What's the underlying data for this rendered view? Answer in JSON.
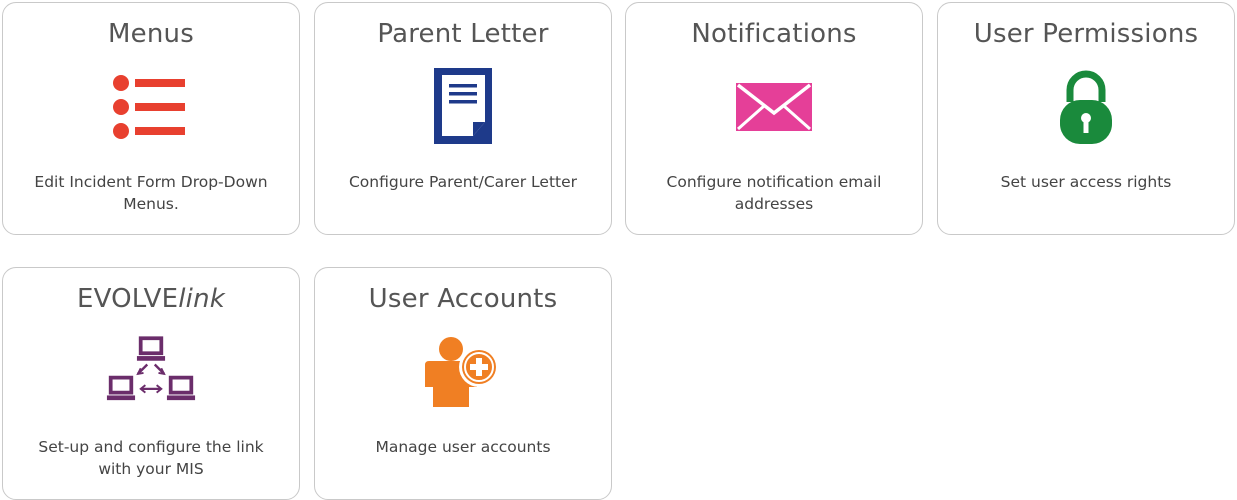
{
  "cards": [
    {
      "title": "Menus",
      "description": "Edit Incident Form Drop-Down Menus.",
      "icon": "list-icon",
      "color": "#e8402f"
    },
    {
      "title": "Parent Letter",
      "description": "Configure Parent/Carer Letter",
      "icon": "document-icon",
      "color": "#1e3a8a"
    },
    {
      "title": "Notifications",
      "description": "Configure notification email addresses",
      "icon": "envelope-icon",
      "color": "#e53f98"
    },
    {
      "title": "User Permissions",
      "description": "Set user access rights",
      "icon": "padlock-icon",
      "color": "#1a8a3c"
    },
    {
      "title_main": "EVOLVE",
      "title_italic": "link",
      "description": "Set-up and configure the link with your MIS",
      "icon": "network-computers-icon",
      "color": "#6b2d6b"
    },
    {
      "title": "User Accounts",
      "description": "Manage user accounts",
      "icon": "add-user-icon",
      "color": "#f07f23"
    }
  ]
}
